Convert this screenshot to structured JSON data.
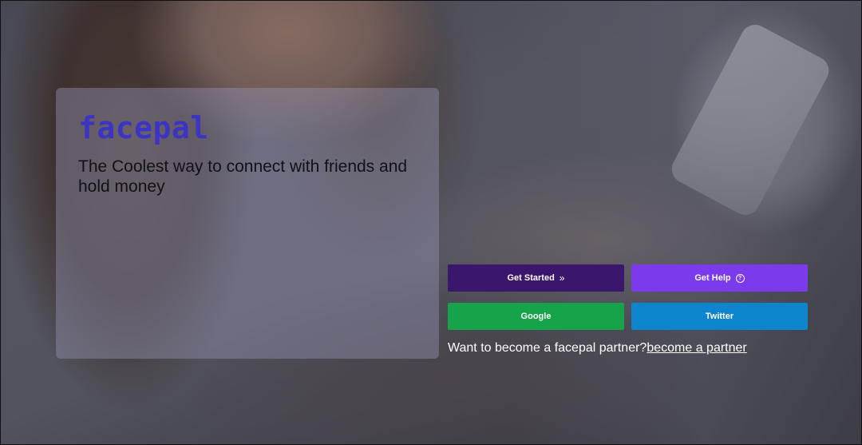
{
  "brand": {
    "name": "facepal",
    "tagline": "The Coolest way to connect with friends and hold money",
    "color": "#3c35c4"
  },
  "actions": {
    "get_started": {
      "label": "Get Started",
      "icon": "double-chevron-right-icon",
      "color": "#3b166d"
    },
    "get_help": {
      "label": "Get Help",
      "icon": "question-circle-icon",
      "color": "#7c3aed"
    },
    "google": {
      "label": "Google",
      "color": "#16a34a"
    },
    "twitter": {
      "label": "Twitter",
      "color": "#0d85cc"
    }
  },
  "partner": {
    "prompt": "Want to become a facepal partner?",
    "link_label": "become a partner"
  }
}
